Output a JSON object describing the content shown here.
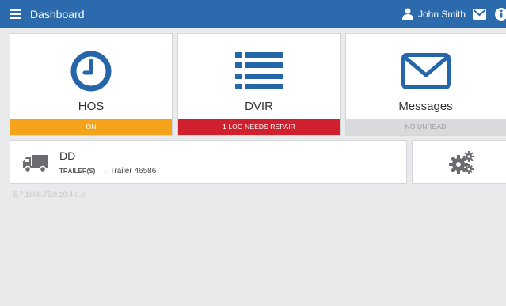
{
  "header": {
    "title": "Dashboard",
    "menu_icon": "hamburger-icon",
    "user_icon": "user-icon",
    "user_name": "John Smith",
    "mail_icon": "envelope-icon",
    "info_icon": "info-icon"
  },
  "tiles": [
    {
      "label": "HOS",
      "icon": "clock-icon",
      "status": "ON",
      "status_color": "#f5a31a"
    },
    {
      "label": "DVIR",
      "icon": "list-icon",
      "status": "1 LOG NEEDS REPAIR",
      "status_color": "#d0202e"
    },
    {
      "label": "Messages",
      "icon": "envelope-icon",
      "status": "NO UNREAD",
      "status_color": "#d9dadc"
    }
  ],
  "vehicle": {
    "icon": "truck-icon",
    "name": "DD",
    "trailer_key": "TRAILER(S)",
    "arrow": "→",
    "trailer_value": "Trailer 46586"
  },
  "settings": {
    "icon": "gears-icon"
  },
  "version": "5.7.1608.75:0.19:4.0.0",
  "colors": {
    "header_bg": "#2a6aad",
    "icon_blue": "#2466a8",
    "page_bg": "#e9eaec"
  }
}
